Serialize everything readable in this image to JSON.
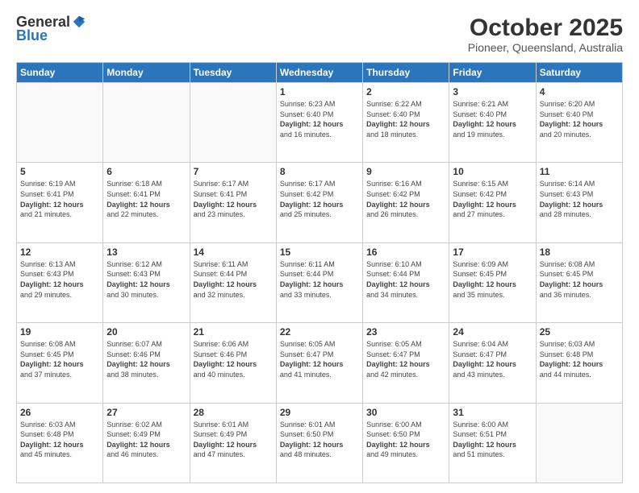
{
  "header": {
    "logo_general": "General",
    "logo_blue": "Blue",
    "title": "October 2025",
    "subtitle": "Pioneer, Queensland, Australia"
  },
  "days_of_week": [
    "Sunday",
    "Monday",
    "Tuesday",
    "Wednesday",
    "Thursday",
    "Friday",
    "Saturday"
  ],
  "weeks": [
    [
      {
        "day": "",
        "info": ""
      },
      {
        "day": "",
        "info": ""
      },
      {
        "day": "",
        "info": ""
      },
      {
        "day": "1",
        "info": "Sunrise: 6:23 AM\nSunset: 6:40 PM\nDaylight: 12 hours\nand 16 minutes."
      },
      {
        "day": "2",
        "info": "Sunrise: 6:22 AM\nSunset: 6:40 PM\nDaylight: 12 hours\nand 18 minutes."
      },
      {
        "day": "3",
        "info": "Sunrise: 6:21 AM\nSunset: 6:40 PM\nDaylight: 12 hours\nand 19 minutes."
      },
      {
        "day": "4",
        "info": "Sunrise: 6:20 AM\nSunset: 6:40 PM\nDaylight: 12 hours\nand 20 minutes."
      }
    ],
    [
      {
        "day": "5",
        "info": "Sunrise: 6:19 AM\nSunset: 6:41 PM\nDaylight: 12 hours\nand 21 minutes."
      },
      {
        "day": "6",
        "info": "Sunrise: 6:18 AM\nSunset: 6:41 PM\nDaylight: 12 hours\nand 22 minutes."
      },
      {
        "day": "7",
        "info": "Sunrise: 6:17 AM\nSunset: 6:41 PM\nDaylight: 12 hours\nand 23 minutes."
      },
      {
        "day": "8",
        "info": "Sunrise: 6:17 AM\nSunset: 6:42 PM\nDaylight: 12 hours\nand 25 minutes."
      },
      {
        "day": "9",
        "info": "Sunrise: 6:16 AM\nSunset: 6:42 PM\nDaylight: 12 hours\nand 26 minutes."
      },
      {
        "day": "10",
        "info": "Sunrise: 6:15 AM\nSunset: 6:42 PM\nDaylight: 12 hours\nand 27 minutes."
      },
      {
        "day": "11",
        "info": "Sunrise: 6:14 AM\nSunset: 6:43 PM\nDaylight: 12 hours\nand 28 minutes."
      }
    ],
    [
      {
        "day": "12",
        "info": "Sunrise: 6:13 AM\nSunset: 6:43 PM\nDaylight: 12 hours\nand 29 minutes."
      },
      {
        "day": "13",
        "info": "Sunrise: 6:12 AM\nSunset: 6:43 PM\nDaylight: 12 hours\nand 30 minutes."
      },
      {
        "day": "14",
        "info": "Sunrise: 6:11 AM\nSunset: 6:44 PM\nDaylight: 12 hours\nand 32 minutes."
      },
      {
        "day": "15",
        "info": "Sunrise: 6:11 AM\nSunset: 6:44 PM\nDaylight: 12 hours\nand 33 minutes."
      },
      {
        "day": "16",
        "info": "Sunrise: 6:10 AM\nSunset: 6:44 PM\nDaylight: 12 hours\nand 34 minutes."
      },
      {
        "day": "17",
        "info": "Sunrise: 6:09 AM\nSunset: 6:45 PM\nDaylight: 12 hours\nand 35 minutes."
      },
      {
        "day": "18",
        "info": "Sunrise: 6:08 AM\nSunset: 6:45 PM\nDaylight: 12 hours\nand 36 minutes."
      }
    ],
    [
      {
        "day": "19",
        "info": "Sunrise: 6:08 AM\nSunset: 6:45 PM\nDaylight: 12 hours\nand 37 minutes."
      },
      {
        "day": "20",
        "info": "Sunrise: 6:07 AM\nSunset: 6:46 PM\nDaylight: 12 hours\nand 38 minutes."
      },
      {
        "day": "21",
        "info": "Sunrise: 6:06 AM\nSunset: 6:46 PM\nDaylight: 12 hours\nand 40 minutes."
      },
      {
        "day": "22",
        "info": "Sunrise: 6:05 AM\nSunset: 6:47 PM\nDaylight: 12 hours\nand 41 minutes."
      },
      {
        "day": "23",
        "info": "Sunrise: 6:05 AM\nSunset: 6:47 PM\nDaylight: 12 hours\nand 42 minutes."
      },
      {
        "day": "24",
        "info": "Sunrise: 6:04 AM\nSunset: 6:47 PM\nDaylight: 12 hours\nand 43 minutes."
      },
      {
        "day": "25",
        "info": "Sunrise: 6:03 AM\nSunset: 6:48 PM\nDaylight: 12 hours\nand 44 minutes."
      }
    ],
    [
      {
        "day": "26",
        "info": "Sunrise: 6:03 AM\nSunset: 6:48 PM\nDaylight: 12 hours\nand 45 minutes."
      },
      {
        "day": "27",
        "info": "Sunrise: 6:02 AM\nSunset: 6:49 PM\nDaylight: 12 hours\nand 46 minutes."
      },
      {
        "day": "28",
        "info": "Sunrise: 6:01 AM\nSunset: 6:49 PM\nDaylight: 12 hours\nand 47 minutes."
      },
      {
        "day": "29",
        "info": "Sunrise: 6:01 AM\nSunset: 6:50 PM\nDaylight: 12 hours\nand 48 minutes."
      },
      {
        "day": "30",
        "info": "Sunrise: 6:00 AM\nSunset: 6:50 PM\nDaylight: 12 hours\nand 49 minutes."
      },
      {
        "day": "31",
        "info": "Sunrise: 6:00 AM\nSunset: 6:51 PM\nDaylight: 12 hours\nand 51 minutes."
      },
      {
        "day": "",
        "info": ""
      }
    ]
  ]
}
